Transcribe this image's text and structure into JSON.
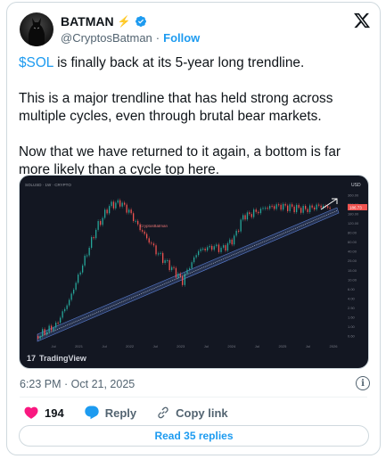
{
  "author": {
    "name": "BATMAN",
    "badge_emoji": "⚡",
    "handle": "@CryptosBatman",
    "separator": "·",
    "follow_label": "Follow"
  },
  "tweet": {
    "cashtag": "$SOL",
    "line1_rest": " is finally back at its 5-year long trendline.",
    "paragraph2": "This is a major trendline that has held strong across multiple cycles, even through brutal bear markets.",
    "paragraph3": "Now that we have returned to it again, a bottom is far more likely than a cycle top here."
  },
  "media": {
    "chart_header": "SOLUSD · 1W · CRYPTO",
    "watermark": "CryptosBatman",
    "brand": "TradingView",
    "currency_label": "USD",
    "price_badge": "186.73",
    "x_ticks": [
      "Jul",
      "2021",
      "Jul",
      "2022",
      "Jul",
      "2023",
      "Jul",
      "2024",
      "Jul",
      "2025",
      "Jul",
      "2026"
    ],
    "y_ticks": [
      "360.00",
      "250.00",
      "180.00",
      "120.00",
      "80.00",
      "60.00",
      "40.00",
      "25.00",
      "15.00",
      "10.00",
      "6.00",
      "4.00",
      "2.50",
      "1.60",
      "1.00",
      "0.60"
    ]
  },
  "meta": {
    "timestamp": "6:23 PM · Oct 21, 2025"
  },
  "actions": {
    "likes": "194",
    "reply_label": "Reply",
    "copy_label": "Copy link",
    "read_replies": "Read 35 replies"
  },
  "colors": {
    "accent": "#1d9bf0",
    "like_red": "#f91880",
    "chart_bg": "#131722",
    "candle_up": "#26a69a",
    "candle_down": "#ef5350",
    "trendline": "#5b7fd4"
  }
}
